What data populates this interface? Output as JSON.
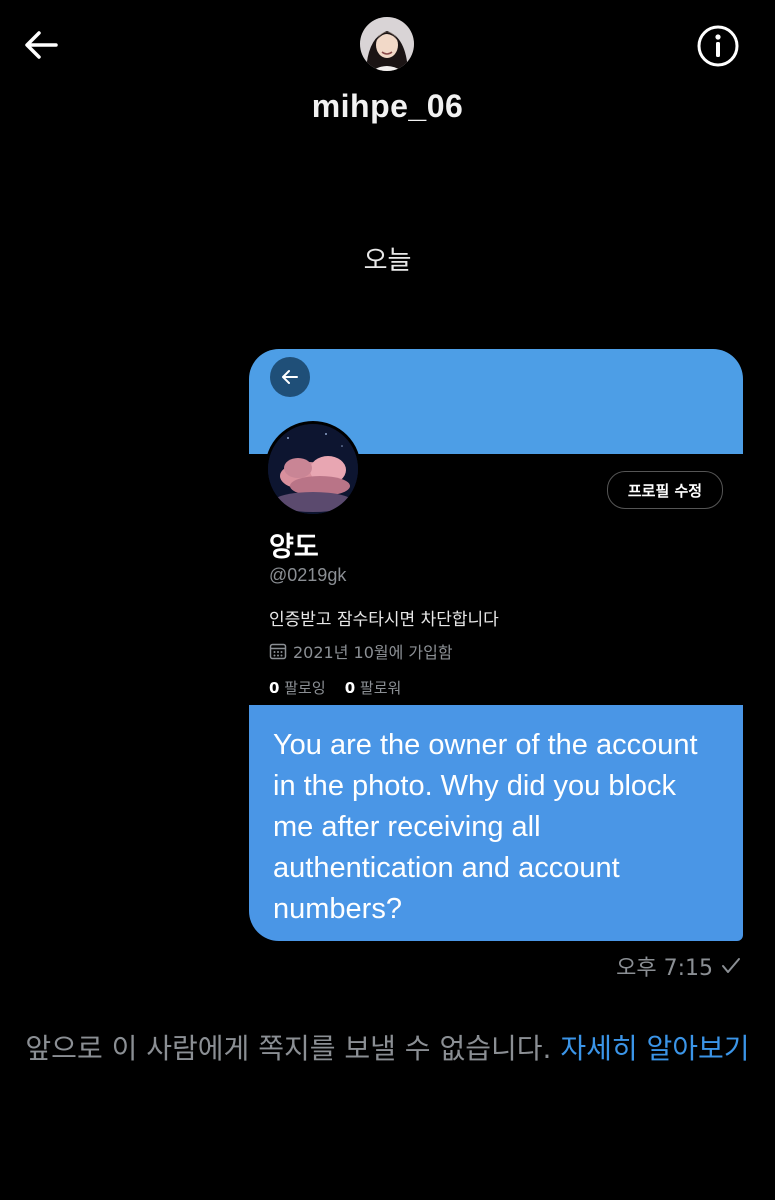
{
  "header": {
    "username": "mihpe_06",
    "back_icon": "arrow-left-icon",
    "info_icon": "info-circle-icon"
  },
  "conversation": {
    "date_separator": "오늘",
    "shared_profile": {
      "name": "양도",
      "handle": "@0219gk",
      "bio": "인증받고 잠수타시면 차단합니다",
      "joined": "2021년 10월에 가입함",
      "following_count": "0",
      "following_label": "팔로잉",
      "followers_count": "0",
      "followers_label": "팔로워",
      "edit_button": "프로필 수정",
      "banner_color": "#4d9ee6"
    },
    "message": {
      "text": "You are the owner of the account in the photo.  Why did you block me after receiving all authentication and account numbers?",
      "time": "오후 7:15",
      "status_icon": "check-icon",
      "bubble_color": "#4a96e6"
    }
  },
  "footer": {
    "notice": "앞으로 이 사람에게 쪽지를 보낼 수 없습니다.",
    "learn_more": "자세히 알아보기",
    "link_color": "#3b95e8"
  }
}
